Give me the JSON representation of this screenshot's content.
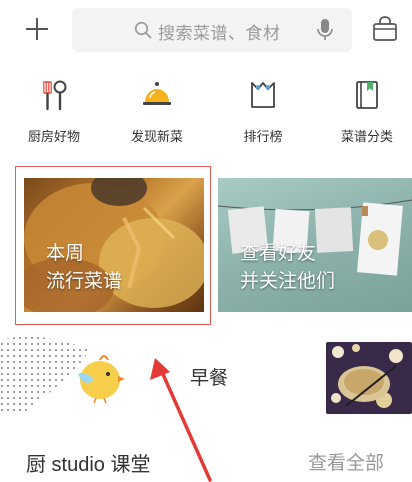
{
  "search": {
    "placeholder": "搜索菜谱、食材"
  },
  "categories": [
    {
      "label": "厨房好物",
      "icon": "kitchen-tools-icon"
    },
    {
      "label": "发现新菜",
      "icon": "dish-bell-icon"
    },
    {
      "label": "排行榜",
      "icon": "ranking-icon"
    },
    {
      "label": "菜谱分类",
      "icon": "recipe-book-icon"
    }
  ],
  "cards": [
    {
      "line1": "本周",
      "line2": "流行菜谱"
    },
    {
      "line1": "查看好友",
      "line2": "并关注他们"
    }
  ],
  "breakfast": {
    "label": "早餐"
  },
  "section": {
    "title": "厨 studio 课堂",
    "more": "查看全部"
  },
  "colors": {
    "highlight": "#e25b55",
    "accent": "#f6b21a"
  }
}
